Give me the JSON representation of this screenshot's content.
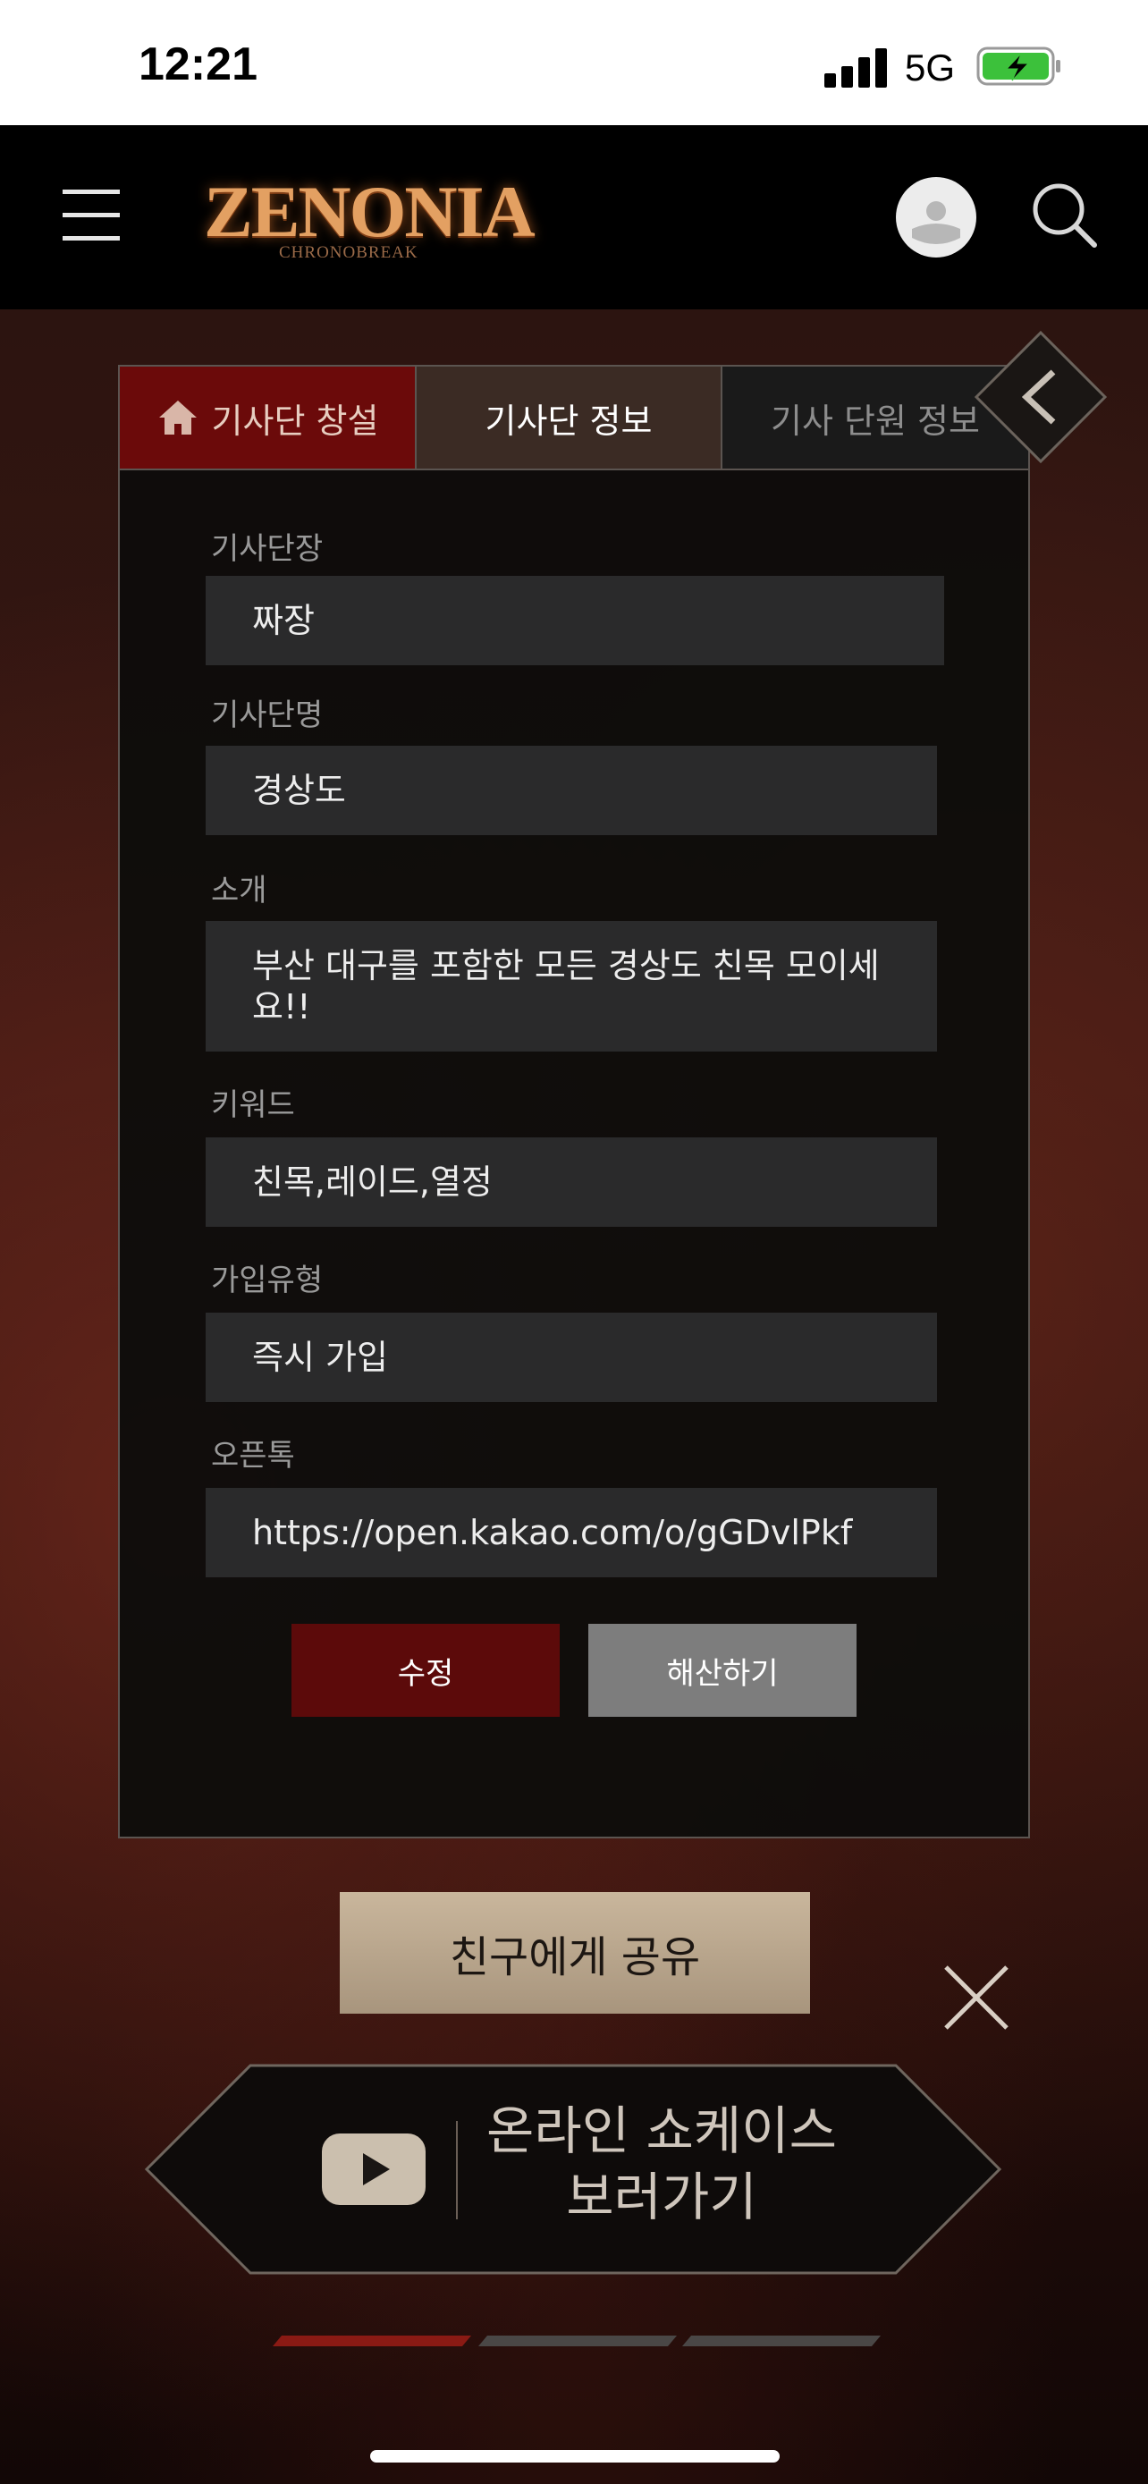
{
  "status_bar": {
    "time": "12:21",
    "network": "5G"
  },
  "header": {
    "logo": "ZENONIA",
    "logo_subtitle": "CHRONOBREAK"
  },
  "tabs": [
    {
      "label": "기사단 창설"
    },
    {
      "label": "기사단 정보"
    },
    {
      "label": "기사 단원 정보"
    }
  ],
  "form": {
    "leader_label": "기사단장",
    "leader_value": "짜장",
    "name_label": "기사단명",
    "name_value": "경상도",
    "intro_label": "소개",
    "intro_value": "부산 대구를 포함한 모든 경상도 친목 모이세요!!",
    "keyword_label": "키워드",
    "keyword_value": "친목,레이드,열정",
    "join_type_label": "가입유형",
    "join_type_value": "즉시 가입",
    "openchat_label": "오픈톡",
    "openchat_value": "https://open.kakao.com/o/gGDvlPkf"
  },
  "buttons": {
    "edit": "수정",
    "dissolve": "해산하기",
    "share": "친구에게 공유"
  },
  "showcase": {
    "line1": "온라인 쇼케이스",
    "line2": "보러가기"
  },
  "colors": {
    "accent_red": "#6b0a0a",
    "share_gold": "#c9b69c",
    "active_indicator": "#8a1a14"
  }
}
